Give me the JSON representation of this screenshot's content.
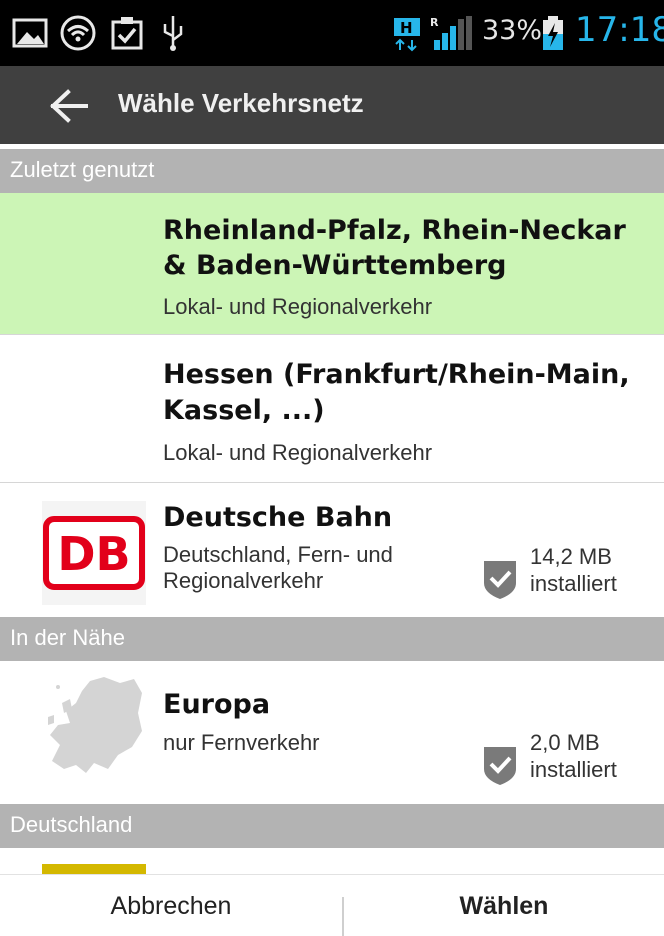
{
  "status_bar": {
    "icons": [
      "image-icon",
      "wifi-icon",
      "clipboard-check-icon",
      "usb-icon",
      "hplus-network-icon",
      "signal-icon",
      "battery-charging-icon"
    ],
    "battery_percent": "33%",
    "time": "17:18",
    "time_color": "#27b6ea"
  },
  "header": {
    "title": "Wähle Verkehrsnetz",
    "background": "#404040"
  },
  "sections": {
    "recent": "Zuletzt genutzt",
    "nearby": "In der Nähe",
    "germany": "Deutschland"
  },
  "items": [
    {
      "title_line1": "Rheinland-Pfalz, Rhein-Neckar",
      "title_line2": "& Baden-Württemberg",
      "subtitle": "Lokal- und Regionalverkehr",
      "selected": true,
      "highlight_color": "#ccf5b6"
    },
    {
      "title_line1": "Hessen (Frankfurt/Rhein-Main,",
      "title_line2": "Kassel, ...)",
      "subtitle": "Lokal- und Regionalverkehr",
      "selected": false
    },
    {
      "title": "Deutsche Bahn",
      "subtitle_line1": "Deutschland, Fern- und",
      "subtitle_line2": "Regionalverkehr",
      "size": "14,2 MB",
      "status": "installiert",
      "logo_text": "DB",
      "logo_color": "#e2001a"
    },
    {
      "title": "Europa",
      "subtitle": "nur Fernverkehr",
      "size": "2,0 MB",
      "status": "installiert"
    }
  ],
  "actions": {
    "cancel": "Abbrechen",
    "confirm": "Wählen"
  }
}
